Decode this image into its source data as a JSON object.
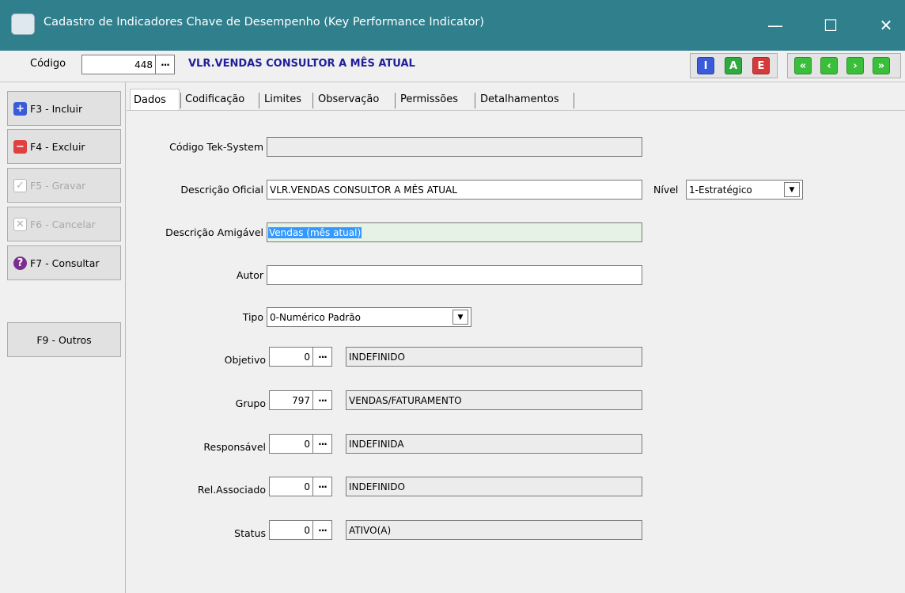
{
  "window": {
    "title": "Cadastro de Indicadores Chave de Desempenho (Key Performance Indicator)",
    "minimize": "—",
    "maximize": "☐",
    "close": "✕"
  },
  "header": {
    "code_label": "Código",
    "code_value": "448",
    "ellipsis": "···",
    "code_description": "VLR.VENDAS CONSULTOR A MÊS ATUAL",
    "mode_buttons": [
      "I",
      "A",
      "E"
    ],
    "mode_colors": [
      "#3a5bd9",
      "#2eaa3e",
      "#d43a3a"
    ],
    "nav_buttons": [
      "«",
      "‹",
      "›",
      "»"
    ],
    "nav_color": "#3bbf3b"
  },
  "sidebar": {
    "buttons": [
      {
        "label": "F3 - Incluir",
        "icon": "+",
        "color": "#3a5bd9"
      },
      {
        "label": "F4 - Excluir",
        "icon": "−",
        "color": "#e04040"
      },
      {
        "label": "F5 - Gravar",
        "icon": "✓",
        "color": "#cccccc"
      },
      {
        "label": "F6 - Cancelar",
        "icon": "✕",
        "color": "#cccccc"
      },
      {
        "label": "F7 - Consultar",
        "icon": "?",
        "color": "#7a2f8f"
      },
      {
        "label": "F9 - Outros",
        "icon": "",
        "color": ""
      }
    ]
  },
  "tabs": [
    "Dados",
    "Codificação",
    "Limites",
    "Observação",
    "Permissões",
    "Detalhamentos"
  ],
  "form": {
    "codigo_tek_label": "Código Tek-System",
    "codigo_tek_value": "",
    "descricao_oficial_label": "Descrição Oficial",
    "descricao_oficial_value": "VLR.VENDAS CONSULTOR A MÊS ATUAL",
    "nivel_label": "Nível",
    "nivel_value": "1-Estratégico",
    "descricao_amigavel_label": "Descrição Amigável",
    "descricao_amigavel_value": "Vendas (mês atual)",
    "autor_label": "Autor",
    "autor_value": "",
    "tipo_label": "Tipo",
    "tipo_value": "0-Numérico Padrão",
    "objetivo_label": "Objetivo",
    "objetivo_code": "0",
    "objetivo_desc": "INDEFINIDO",
    "grupo_label": "Grupo",
    "grupo_code": "797",
    "grupo_desc": "VENDAS/FATURAMENTO",
    "responsavel_label": "Responsável",
    "responsavel_code": "0",
    "responsavel_desc": "INDEFINIDA",
    "rel_label": "Rel.Associado",
    "rel_code": "0",
    "rel_desc": "INDEFINIDO",
    "status_label": "Status",
    "status_code": "0",
    "status_desc": "ATIVO(A)",
    "dropdown_arrow": "▼"
  }
}
